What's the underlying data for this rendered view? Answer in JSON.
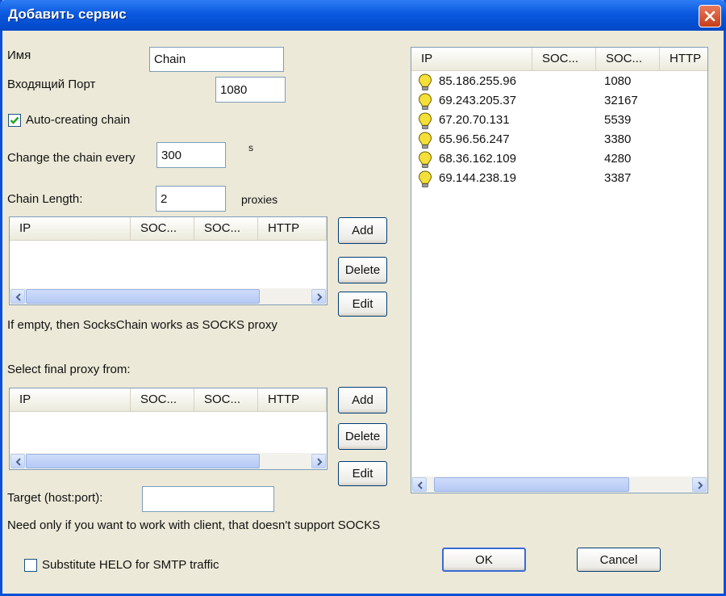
{
  "window": {
    "title": "Добавить сервис"
  },
  "form": {
    "name_label": "Имя",
    "name_value": "Chain",
    "port_label": "Входящий Порт",
    "port_value": "1080",
    "autochain_label": "Auto-creating chain",
    "change_label": "Change the chain every",
    "change_value": "300",
    "change_unit": "s",
    "length_label": "Chain Length:",
    "length_value": "2",
    "length_unit": "proxies",
    "empty_hint": "If empty, then SocksChain works as SOCKS proxy",
    "final_label": "Select final proxy from:",
    "target_label": "Target (host:port):",
    "target_value": "",
    "target_hint": "Need only if you want to work with client, that doesn't support SOCKS",
    "helo_label": "Substitute HELO for SMTP traffic"
  },
  "columns": [
    "IP",
    "SOC...",
    "SOC...",
    "HTTP"
  ],
  "buttons": {
    "add": "Add",
    "delete": "Delete",
    "edit": "Edit",
    "ok": "OK",
    "cancel": "Cancel"
  },
  "proxies": [
    {
      "ip": "85.186.255.96",
      "port": "1080"
    },
    {
      "ip": "69.243.205.37",
      "port": "32167"
    },
    {
      "ip": "67.20.70.131",
      "port": "5539"
    },
    {
      "ip": "65.96.56.247",
      "port": "3380"
    },
    {
      "ip": "68.36.162.109",
      "port": "4280"
    },
    {
      "ip": "69.144.238.19",
      "port": "3387"
    }
  ],
  "colors": {
    "titlebar": "#0a59e0",
    "dialog_bg": "#ece9d8",
    "bulb": "#f5e03a",
    "check": "#21a121"
  },
  "icons": {
    "status": "lightbulb-icon",
    "check": "checkmark-icon",
    "close": "close-icon"
  }
}
